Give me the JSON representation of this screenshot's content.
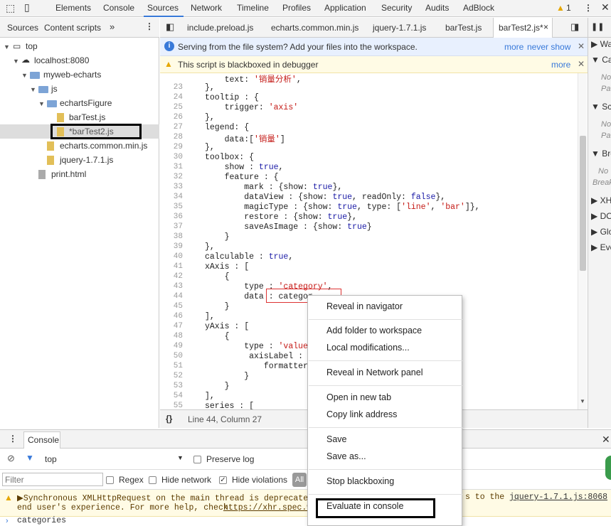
{
  "toolbar": {
    "tabs": [
      "Elements",
      "Console",
      "Sources",
      "Network",
      "Timeline",
      "Profiles",
      "Application",
      "Security",
      "Audits",
      "AdBlock"
    ],
    "active_tab": "Sources",
    "warning_count": "1"
  },
  "navigator": {
    "tabs": [
      "Sources",
      "Content scripts"
    ],
    "tree": {
      "top": "top",
      "host": "localhost:8080",
      "project": "myweb-echarts",
      "js": "js",
      "echarts_figure": "echartsFigure",
      "bar_test": "barTest.js",
      "bar_test2": "*barTest2.js",
      "echarts_common": "echarts.common.min.js",
      "jquery": "jquery-1.7.1.js",
      "print": "print.html"
    }
  },
  "editor": {
    "tabs": [
      "include.preload.js",
      "echarts.common.min.js",
      "jquery-1.7.1.js",
      "barTest.js",
      "barTest2.js*"
    ],
    "infobar": {
      "text": "Serving from the file system? Add your files into the workspace.",
      "more": "more",
      "never_show": "never show"
    },
    "blackbox_bar": {
      "text": "This script is blackboxed in debugger",
      "more": "more"
    },
    "code": [
      {
        "n": "",
        "t": "    text: '销量分析',"
      },
      {
        "n": "23",
        "t": "},"
      },
      {
        "n": "24",
        "t": "tooltip : {"
      },
      {
        "n": "25",
        "t": "    trigger: 'axis'"
      },
      {
        "n": "26",
        "t": "},"
      },
      {
        "n": "27",
        "t": "legend: {"
      },
      {
        "n": "28",
        "t": "    data:['销量']"
      },
      {
        "n": "29",
        "t": "},"
      },
      {
        "n": "30",
        "t": "toolbox: {"
      },
      {
        "n": "31",
        "t": "    show : true,"
      },
      {
        "n": "32",
        "t": "    feature : {"
      },
      {
        "n": "33",
        "t": "        mark : {show: true},"
      },
      {
        "n": "34",
        "t": "        dataView : {show: true, readOnly: false},"
      },
      {
        "n": "35",
        "t": "        magicType : {show: true, type: ['line', 'bar']},"
      },
      {
        "n": "36",
        "t": "        restore : {show: true},"
      },
      {
        "n": "37",
        "t": "        saveAsImage : {show: true}"
      },
      {
        "n": "38",
        "t": "    }"
      },
      {
        "n": "39",
        "t": "},"
      },
      {
        "n": "40",
        "t": "calculable : true,"
      },
      {
        "n": "41",
        "t": "xAxis : ["
      },
      {
        "n": "42",
        "t": "    {"
      },
      {
        "n": "43",
        "t": "        type : 'category',"
      },
      {
        "n": "44",
        "t": "        data : categor"
      },
      {
        "n": "45",
        "t": "    }"
      },
      {
        "n": "46",
        "t": "],"
      },
      {
        "n": "47",
        "t": "yAxis : ["
      },
      {
        "n": "48",
        "t": "    {"
      },
      {
        "n": "49",
        "t": "        type : 'value'"
      },
      {
        "n": "50",
        "t": "         axisLabel : {"
      },
      {
        "n": "51",
        "t": "            formatter:"
      },
      {
        "n": "52",
        "t": "        }"
      },
      {
        "n": "53",
        "t": "    }"
      },
      {
        "n": "54",
        "t": "],"
      },
      {
        "n": "55",
        "t": "series : ["
      }
    ],
    "status": "Line 44, Column 27",
    "format_icon": "{}"
  },
  "right_panel": {
    "sections": [
      "Wa",
      "Ca",
      "Sc",
      "Bre",
      "XH",
      "DO",
      "Glo",
      "Eve"
    ],
    "notes": [
      "Not",
      "Paus",
      "Not",
      "Paus",
      "No",
      "Break"
    ]
  },
  "console": {
    "tab": "Console",
    "context": "top",
    "preserve_log": "Preserve log",
    "filter_placeholder": "Filter",
    "regex": "Regex",
    "hide_network": "Hide network",
    "hide_violations": "Hide violations",
    "all": "All",
    "warning_line1": "▶Synchronous XMLHttpRequest on the main thread is deprecated b",
    "warning_line1_tail": "s to the",
    "warning_link": "jquery-1.7.1.js:8068",
    "warning_line2": "end user's experience. For more help, check",
    "warning_url": "https://xhr.spec.w",
    "input_text": "categories"
  },
  "context_menu": {
    "items": [
      "Reveal in navigator",
      "Add folder to workspace",
      "Local modifications...",
      "Reveal in Network panel",
      "Open in new tab",
      "Copy link address",
      "Save",
      "Save as...",
      "Stop blackboxing",
      "Evaluate in console"
    ]
  }
}
